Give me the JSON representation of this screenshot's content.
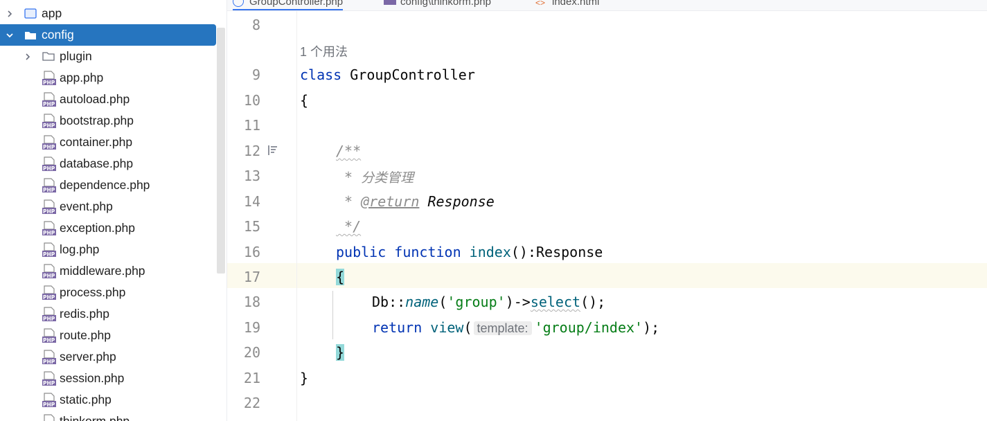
{
  "tabs": [
    {
      "label": "GroupController.php",
      "active": true
    },
    {
      "label": "config\\thinkorm.php",
      "active": false
    },
    {
      "label": "index.html",
      "active": false
    }
  ],
  "project_tree": {
    "items": [
      {
        "label": "app",
        "kind": "folder",
        "expanded": false,
        "depth": 0
      },
      {
        "label": "config",
        "kind": "folder",
        "expanded": true,
        "selected": true,
        "depth": 0
      },
      {
        "label": "plugin",
        "kind": "folder",
        "expanded": false,
        "depth": 1
      },
      {
        "label": "app.php",
        "kind": "php",
        "depth": 1
      },
      {
        "label": "autoload.php",
        "kind": "php",
        "depth": 1
      },
      {
        "label": "bootstrap.php",
        "kind": "php",
        "depth": 1
      },
      {
        "label": "container.php",
        "kind": "php",
        "depth": 1
      },
      {
        "label": "database.php",
        "kind": "php",
        "depth": 1
      },
      {
        "label": "dependence.php",
        "kind": "php",
        "depth": 1
      },
      {
        "label": "event.php",
        "kind": "php",
        "depth": 1
      },
      {
        "label": "exception.php",
        "kind": "php",
        "depth": 1
      },
      {
        "label": "log.php",
        "kind": "php",
        "depth": 1
      },
      {
        "label": "middleware.php",
        "kind": "php",
        "depth": 1
      },
      {
        "label": "process.php",
        "kind": "php",
        "depth": 1
      },
      {
        "label": "redis.php",
        "kind": "php",
        "depth": 1
      },
      {
        "label": "route.php",
        "kind": "php",
        "depth": 1
      },
      {
        "label": "server.php",
        "kind": "php",
        "depth": 1
      },
      {
        "label": "session.php",
        "kind": "php",
        "depth": 1
      },
      {
        "label": "static.php",
        "kind": "php",
        "depth": 1
      },
      {
        "label": "thinkorm.php",
        "kind": "php",
        "depth": 1
      }
    ]
  },
  "editor": {
    "usage_hint": "1 个用法",
    "line_numbers": [
      "8",
      "9",
      "10",
      "11",
      "12",
      "13",
      "14",
      "15",
      "16",
      "17",
      "18",
      "19",
      "20",
      "21",
      "22"
    ],
    "tokens": {
      "l9_kw": "class",
      "l9_name": " GroupController",
      "l10": "{",
      "l12": "/**",
      "l13_star": " * ",
      "l13_text": "分类管理",
      "l14_star": " * ",
      "l14_tag": "@return",
      "l14_type": " Response",
      "l15": " */",
      "l16_kw1": "public",
      "l16_kw2": " function",
      "l16_fn": " index",
      "l16_rest": "():Response",
      "l17": "{",
      "l18_a": "Db::",
      "l18_name": "name",
      "l18_b": "(",
      "l18_str": "'group'",
      "l18_c": ")->",
      "l18_select": "select",
      "l18_d": "();",
      "l19_kw": "return",
      "l19_fn": " view",
      "l19_paren": "(",
      "l19_hint": "template:",
      "l19_str": "'group/index'",
      "l19_end": ");",
      "l20": "}",
      "l21": "}"
    }
  },
  "colors": {
    "selection": "#2675bf",
    "keyword": "#0033b3",
    "string": "#067d17",
    "caret_row": "#fcfaed",
    "brace_match": "#93d9d9"
  }
}
